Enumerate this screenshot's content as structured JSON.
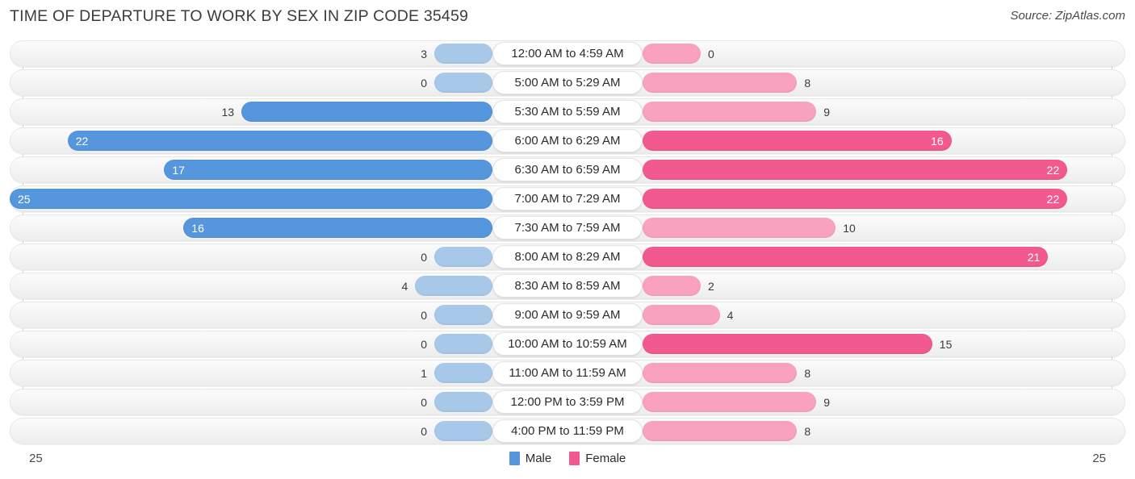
{
  "header": {
    "title": "TIME OF DEPARTURE TO WORK BY SEX IN ZIP CODE 35459",
    "source": "Source: ZipAtlas.com"
  },
  "legend": {
    "male_label": "Male",
    "female_label": "Female",
    "male_color": "#5596dc",
    "female_color": "#f2598e"
  },
  "axis": {
    "left_min": "25",
    "right_min": "25"
  },
  "colors": {
    "male_strong": "#5596dc",
    "male_light": "#a8c8ea",
    "female_strong": "#f2598e",
    "female_light": "#f9a2c0"
  },
  "chart_data": {
    "type": "bar",
    "orientation": "horizontal-diverging",
    "title": "TIME OF DEPARTURE TO WORK BY SEX IN ZIP CODE 35459",
    "subtitle": "Source: ZipAtlas.com",
    "xlabel": "",
    "ylabel": "",
    "xlim": [
      0,
      25
    ],
    "axis_max": 25,
    "grid": true,
    "legend_position": "bottom-center",
    "categories": [
      "12:00 AM to 4:59 AM",
      "5:00 AM to 5:29 AM",
      "5:30 AM to 5:59 AM",
      "6:00 AM to 6:29 AM",
      "6:30 AM to 6:59 AM",
      "7:00 AM to 7:29 AM",
      "7:30 AM to 7:59 AM",
      "8:00 AM to 8:29 AM",
      "8:30 AM to 8:59 AM",
      "9:00 AM to 9:59 AM",
      "10:00 AM to 10:59 AM",
      "11:00 AM to 11:59 AM",
      "12:00 PM to 3:59 PM",
      "4:00 PM to 11:59 PM"
    ],
    "series": [
      {
        "name": "Male",
        "values": [
          3,
          0,
          13,
          22,
          17,
          25,
          16,
          0,
          4,
          0,
          0,
          1,
          0,
          0
        ]
      },
      {
        "name": "Female",
        "values": [
          0,
          8,
          9,
          16,
          22,
          22,
          10,
          21,
          2,
          4,
          15,
          8,
          9,
          8
        ]
      }
    ]
  },
  "rows": [
    {
      "category": "12:00 AM to 4:59 AM",
      "male": "3",
      "female": "0"
    },
    {
      "category": "5:00 AM to 5:29 AM",
      "male": "0",
      "female": "8"
    },
    {
      "category": "5:30 AM to 5:59 AM",
      "male": "13",
      "female": "9"
    },
    {
      "category": "6:00 AM to 6:29 AM",
      "male": "22",
      "female": "16"
    },
    {
      "category": "6:30 AM to 6:59 AM",
      "male": "17",
      "female": "22"
    },
    {
      "category": "7:00 AM to 7:29 AM",
      "male": "25",
      "female": "22"
    },
    {
      "category": "7:30 AM to 7:59 AM",
      "male": "16",
      "female": "10"
    },
    {
      "category": "8:00 AM to 8:29 AM",
      "male": "0",
      "female": "21"
    },
    {
      "category": "8:30 AM to 8:59 AM",
      "male": "4",
      "female": "2"
    },
    {
      "category": "9:00 AM to 9:59 AM",
      "male": "0",
      "female": "4"
    },
    {
      "category": "10:00 AM to 10:59 AM",
      "male": "0",
      "female": "15"
    },
    {
      "category": "11:00 AM to 11:59 AM",
      "male": "1",
      "female": "8"
    },
    {
      "category": "12:00 PM to 3:59 PM",
      "male": "0",
      "female": "9"
    },
    {
      "category": "4:00 PM to 11:59 PM",
      "male": "0",
      "female": "8"
    }
  ]
}
